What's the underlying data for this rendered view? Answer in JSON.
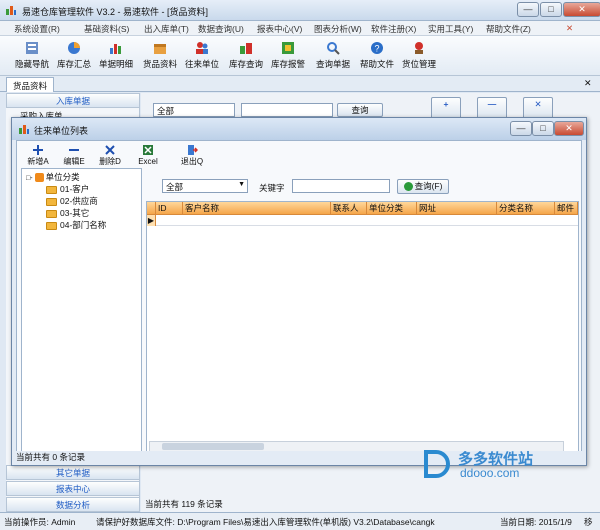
{
  "app": {
    "title": "易速仓库管理软件 V3.2 - 易速软件 - [货品资料]"
  },
  "menu": [
    "系统设置(R)",
    "基础资料(S)",
    "出入库单(T)",
    "数据查询(U)",
    "报表中心(V)",
    "图表分析(W)",
    "软件注册(X)",
    "实用工具(Y)",
    "帮助文件(Z)"
  ],
  "toolbar": [
    "隐藏导航",
    "库存汇总",
    "单据明细",
    "货品资料",
    "往来单位",
    "库存查询",
    "库存报警",
    "查询单据",
    "帮助文件",
    "货位管理"
  ],
  "doctab": "货品资料",
  "nav": {
    "top": "入库单据",
    "item": "采购入库单",
    "bottom": [
      "其它单据",
      "报表中心",
      "数据分析"
    ]
  },
  "main": {
    "filter": "全部",
    "query": "查询",
    "count": "当前共有 119 条记录",
    "btn_new": "新增",
    "btn_edit": "编辑",
    "btn_del": "删除"
  },
  "dialog": {
    "title": "往来单位列表",
    "toolbar": [
      "新增A",
      "编辑E",
      "删除D",
      "Excel",
      "退出Q"
    ],
    "tree_root": "单位分类",
    "tree_items": [
      "01-客户",
      "02-供应商",
      "03-其它",
      "04-部门名称"
    ],
    "filter": "全部",
    "keyword_label": "关键字",
    "keyword_value": "",
    "query_btn": "查询(F)",
    "columns": [
      "ID",
      "客户名称",
      "联系人",
      "单位分类",
      "网址",
      "分类名称",
      "邮件"
    ],
    "status": "当前共有 0 条记录"
  },
  "status": {
    "operator": "当前操作员: Admin",
    "tip": "请保护好数据库文件: D:\\Program Files\\易速出入库管理软件(单机版) V3.2\\Database\\cangk",
    "date": "当前日期: 2015/1/9",
    "extra": "移"
  },
  "watermark": {
    "name": "多多软件站",
    "url": "ddooo.com"
  },
  "colors": {
    "accent": "#1e5bc4",
    "grid_header": "#f5a64a",
    "close": "#c84a32"
  }
}
